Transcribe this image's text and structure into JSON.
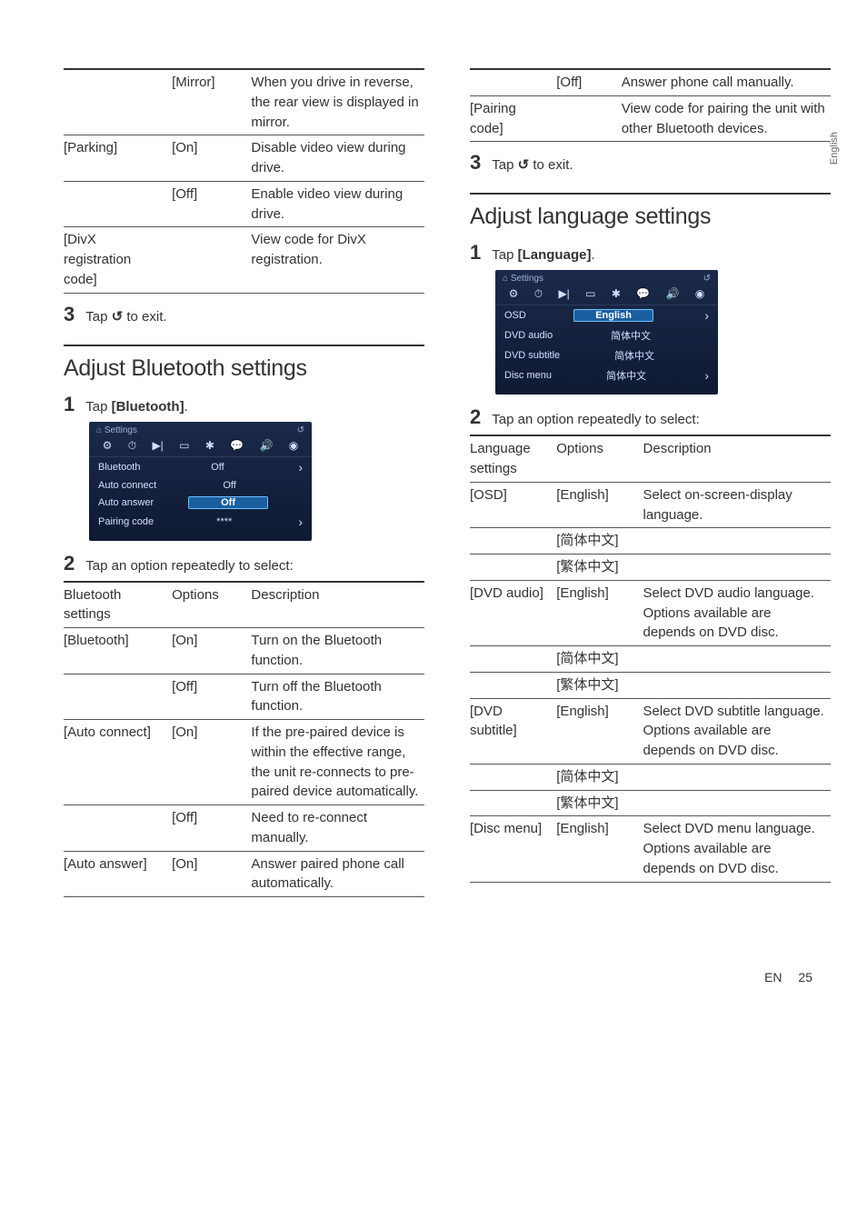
{
  "langTab": "English",
  "footer": {
    "lang": "EN",
    "page": "25"
  },
  "col1": {
    "table1": {
      "rows": [
        {
          "c1": "",
          "c2": "[Mirror]",
          "c3": "When you drive in reverse, the rear view is displayed in mirror."
        },
        {
          "c1": "[Parking]",
          "c2": "[On]",
          "c3": "Disable video view during drive."
        },
        {
          "c1": "",
          "c2": "[Off]",
          "c3": "Enable video view during drive."
        },
        {
          "c1": "[DivX registration code]",
          "c2": "",
          "c3": "View code for DivX registration."
        }
      ]
    },
    "step3": {
      "num": "3",
      "pre": "Tap ",
      "icon": "↺",
      "post": " to exit."
    },
    "h_bt": "Adjust Bluetooth settings",
    "bt_step1": {
      "num": "1",
      "pre": "Tap ",
      "bold": "[Bluetooth]",
      "post": "."
    },
    "bt_screenshot": {
      "title": "Settings",
      "rows": [
        {
          "label": "Bluetooth",
          "val": "Off",
          "hl": false
        },
        {
          "label": "Auto connect",
          "val": "Off",
          "hl": false
        },
        {
          "label": "Auto answer",
          "val": "Off",
          "hl": true
        },
        {
          "label": "Pairing code",
          "val": "****",
          "hl": false
        }
      ]
    },
    "bt_step2": {
      "num": "2",
      "txt": "Tap an option repeatedly to select:"
    },
    "bt_table": {
      "head": {
        "c1": "Bluetooth settings",
        "c2": "Options",
        "c3": "Description"
      },
      "rows": [
        {
          "c1": "[Bluetooth]",
          "c2": "[On]",
          "c3": "Turn on the Bluetooth function."
        },
        {
          "c1": "",
          "c2": "[Off]",
          "c3": "Turn off the Bluetooth function."
        },
        {
          "c1": "[Auto connect]",
          "c2": "[On]",
          "c3": "If the pre-paired device is within the effective range, the unit re-connects to pre-paired device automatically."
        },
        {
          "c1": "",
          "c2": "[Off]",
          "c3": "Need to re-connect manually."
        },
        {
          "c1": "[Auto answer]",
          "c2": "[On]",
          "c3": "Answer paired phone call automatically."
        }
      ]
    }
  },
  "col2": {
    "table_cont": {
      "rows": [
        {
          "c1": "",
          "c2": "[Off]",
          "c3": "Answer phone call manually."
        },
        {
          "c1": "[Pairing code]",
          "c2": "",
          "c3": "View code for pairing the unit with other Bluetooth devices."
        }
      ]
    },
    "step3": {
      "num": "3",
      "pre": "Tap ",
      "icon": "↺",
      "post": " to exit."
    },
    "h_lang": "Adjust language settings",
    "lang_step1": {
      "num": "1",
      "pre": "Tap ",
      "bold": "[Language]",
      "post": "."
    },
    "lang_screenshot": {
      "title": "Settings",
      "rows": [
        {
          "label": "OSD",
          "val": "English",
          "hl": true
        },
        {
          "label": "DVD audio",
          "val": "简体中文",
          "hl": false
        },
        {
          "label": "DVD subtitle",
          "val": "简体中文",
          "hl": false
        },
        {
          "label": "Disc menu",
          "val": "简体中文",
          "hl": false
        }
      ]
    },
    "lang_step2": {
      "num": "2",
      "txt": "Tap an option repeatedly to select:"
    },
    "lang_table": {
      "head": {
        "c1": "Language settings",
        "c2": "Options",
        "c3": "Description"
      },
      "rows": [
        {
          "c1": "[OSD]",
          "c2": "[English]",
          "c3": "Select on-screen-display language."
        },
        {
          "c1": "",
          "c2": "[简体中文]",
          "c3": ""
        },
        {
          "c1": "",
          "c2": "[繁体中文]",
          "c3": ""
        },
        {
          "c1": "[DVD audio]",
          "c2": "[English]",
          "c3": "Select DVD audio language. Options available are depends on DVD disc."
        },
        {
          "c1": "",
          "c2": "[简体中文]",
          "c3": ""
        },
        {
          "c1": "",
          "c2": "[繁体中文]",
          "c3": ""
        },
        {
          "c1": "[DVD subtitle]",
          "c2": "[English]",
          "c3": "Select DVD subtitle language. Options available are depends on DVD disc."
        },
        {
          "c1": "",
          "c2": "[简体中文]",
          "c3": ""
        },
        {
          "c1": "",
          "c2": "[繁体中文]",
          "c3": ""
        },
        {
          "c1": "[Disc menu]",
          "c2": "[English]",
          "c3": "Select DVD menu language. Options available are depends on DVD disc."
        }
      ]
    }
  }
}
